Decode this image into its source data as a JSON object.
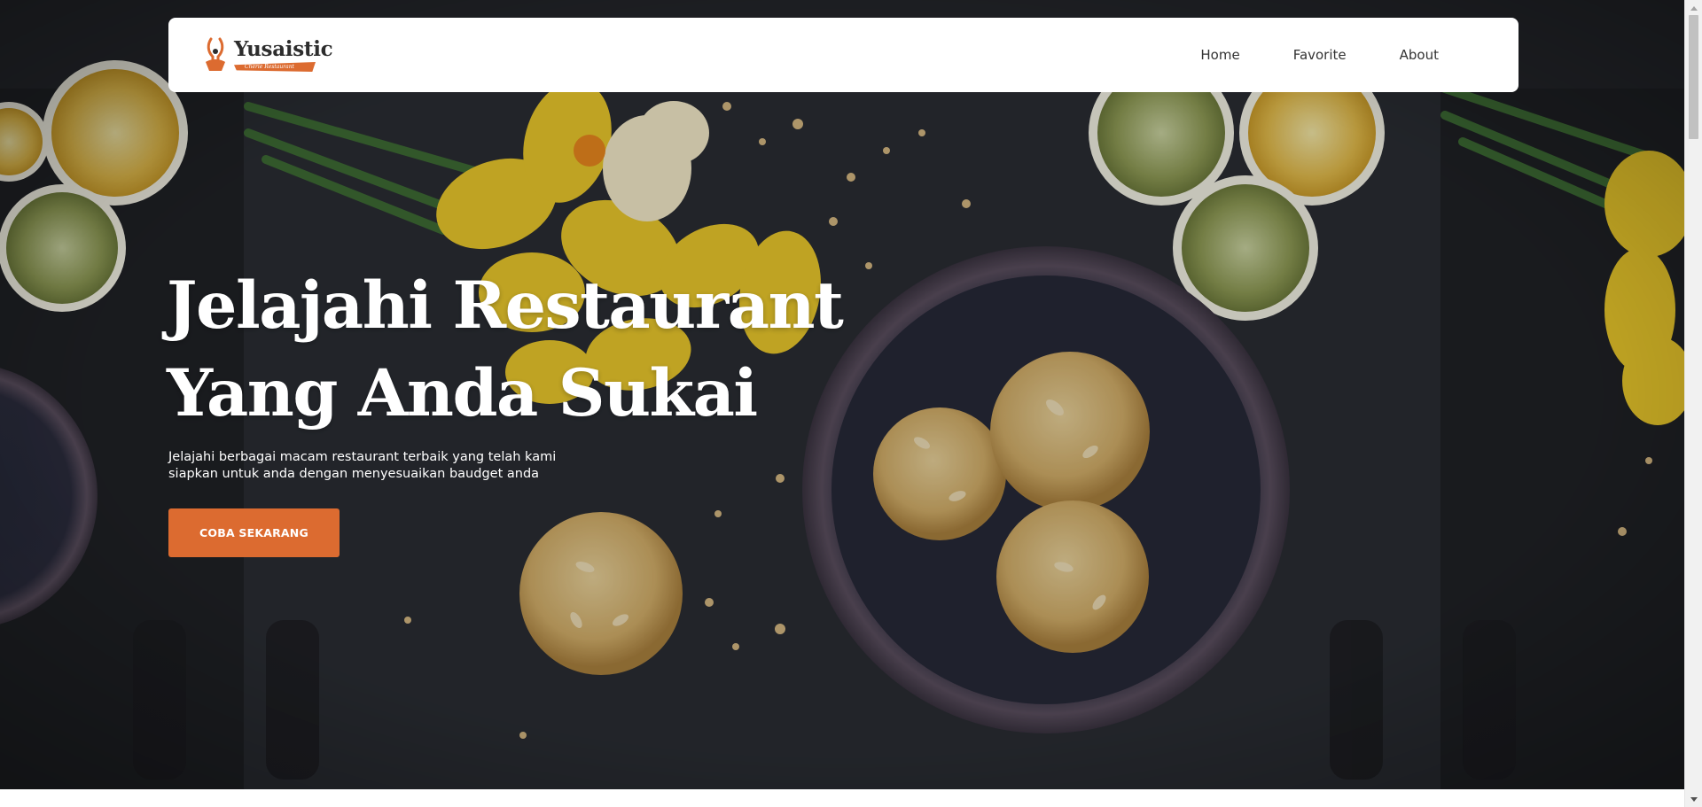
{
  "brand": {
    "name": "Yusaistic",
    "tagline": "Cherie Restaurant",
    "logo_icon": "chef-whisk-icon"
  },
  "nav": {
    "items": [
      {
        "label": "Home"
      },
      {
        "label": "Favorite"
      },
      {
        "label": "About"
      }
    ]
  },
  "hero": {
    "title_line1": "Jelajahi Restaurant",
    "title_line2": "Yang Anda Sukai",
    "subtitle_line1": "Jelajahi berbagai macam restaurant terbaik yang telah kami",
    "subtitle_line2": "siapkan untuk anda dengan menyesuaikan baudget anda",
    "cta_label": "COBA SEKARANG",
    "background_image": "cookies-lemons-daffodils-on-dark-table"
  },
  "colors": {
    "accent": "#dc6b30",
    "navbar_bg": "#ffffff",
    "hero_bg": "#232529",
    "hero_text": "#ffffff"
  }
}
